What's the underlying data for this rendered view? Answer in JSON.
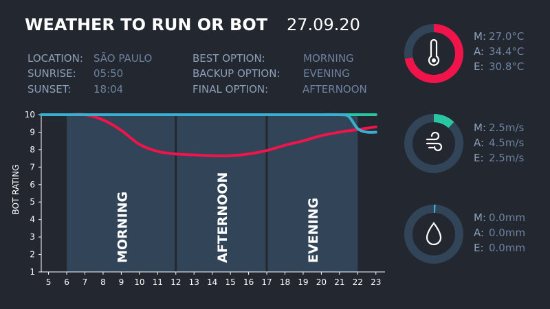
{
  "header": {
    "title": "WEATHER TO RUN OR BOT",
    "date": "27.09.20"
  },
  "info": {
    "location_label": "LOCATION:",
    "location_value": "SÃO PAULO",
    "sunrise_label": "SUNRISE:",
    "sunrise_value": "05:50",
    "sunset_label": "SUNSET:",
    "sunset_value": "18:04",
    "best_label": "BEST OPTION:",
    "best_value": "MORNING",
    "backup_label": "BACKUP OPTION:",
    "backup_value": "EVENING",
    "final_label": "FINAL OPTION:",
    "final_value": "AFTERNOON"
  },
  "gauges": [
    {
      "icon": "thermometer-icon",
      "fill_fraction": 0.72,
      "color": "#f0144b",
      "rows": [
        {
          "key": "M:",
          "value": "27.0°C"
        },
        {
          "key": "A:",
          "value": "34.4°C"
        },
        {
          "key": "E:",
          "value": "30.8°C"
        }
      ]
    },
    {
      "icon": "wind-icon",
      "fill_fraction": 0.12,
      "color": "#2ac6a4",
      "rows": [
        {
          "key": "M:",
          "value": "2.5m/s"
        },
        {
          "key": "A:",
          "value": "4.5m/s"
        },
        {
          "key": "E:",
          "value": "2.5m/s"
        }
      ]
    },
    {
      "icon": "raindrop-icon",
      "fill_fraction": 0.01,
      "color": "#3ab0d0",
      "rows": [
        {
          "key": "M:",
          "value": "0.0mm"
        },
        {
          "key": "A:",
          "value": "0.0mm"
        },
        {
          "key": "E:",
          "value": "0.0mm"
        }
      ]
    }
  ],
  "chart_data": {
    "type": "line",
    "ylabel": "BOT RATING",
    "xlabel": "",
    "xlim": [
      4.6,
      23.5
    ],
    "ylim": [
      1,
      10
    ],
    "x_ticks": [
      5,
      6,
      7,
      8,
      9,
      10,
      11,
      12,
      13,
      14,
      15,
      16,
      17,
      18,
      19,
      20,
      21,
      22,
      23
    ],
    "y_ticks": [
      1,
      2,
      3,
      4,
      5,
      6,
      7,
      8,
      9,
      10
    ],
    "bands": [
      {
        "label": "MORNING",
        "x_start": 6,
        "x_end": 12
      },
      {
        "label": "AFTERNOON",
        "x_start": 12,
        "x_end": 17
      },
      {
        "label": "EVENING",
        "x_start": 17,
        "x_end": 22
      }
    ],
    "series": [
      {
        "color": "#f0144b",
        "x": [
          4.6,
          5,
          6,
          7,
          8,
          9,
          10,
          11,
          12,
          13,
          14,
          15,
          16,
          17,
          18,
          19,
          20,
          21,
          22,
          23
        ],
        "y": [
          10,
          10,
          10,
          10,
          9.7,
          9.1,
          8.3,
          7.9,
          7.75,
          7.7,
          7.65,
          7.65,
          7.75,
          7.95,
          8.25,
          8.5,
          8.8,
          9.0,
          9.15,
          9.3
        ]
      },
      {
        "color": "#2ac6a4",
        "x": [
          4.6,
          23
        ],
        "y": [
          10,
          10
        ]
      },
      {
        "color": "#3ab0d0",
        "x": [
          4.6,
          5,
          6,
          7,
          8,
          9,
          10,
          11,
          12,
          13,
          14,
          15,
          16,
          17,
          18,
          19,
          20,
          21,
          21.5,
          22,
          22.5,
          23
        ],
        "y": [
          10,
          10,
          10,
          10,
          10,
          10,
          10,
          10,
          10,
          10,
          10,
          10,
          10,
          10,
          10,
          10,
          10,
          10,
          9.9,
          9.2,
          9.0,
          9.0
        ]
      }
    ]
  }
}
